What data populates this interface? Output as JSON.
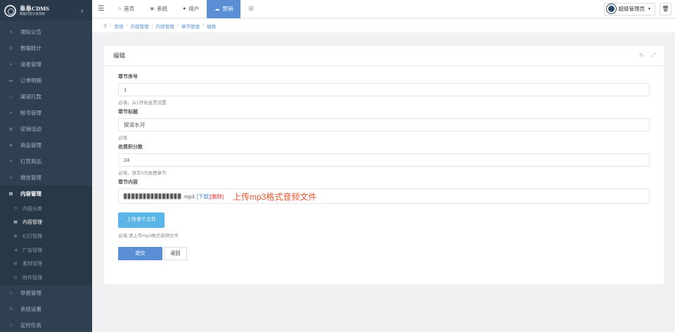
{
  "brand": {
    "title": "阜阜CDMS",
    "subtitle": "数据内容分发系统"
  },
  "sidebar": {
    "items": [
      {
        "label": "通知公告",
        "icon": "comment-icon"
      },
      {
        "label": "数据统计",
        "icon": "bar-chart-icon"
      },
      {
        "label": "读者管理",
        "icon": "users-icon"
      },
      {
        "label": "订单明细",
        "icon": "cart-icon"
      },
      {
        "label": "渠道打款",
        "icon": "money-icon"
      },
      {
        "label": "帐号管理",
        "icon": "user-icon"
      },
      {
        "label": "促销活动",
        "icon": "gift-icon"
      },
      {
        "label": "商品管理",
        "icon": "diamond-icon"
      },
      {
        "label": "打赏商品",
        "icon": "heart-icon"
      },
      {
        "label": "微信管理",
        "icon": "wechat-icon"
      },
      {
        "label": "内容管理",
        "icon": "book-icon"
      },
      {
        "label": "举报管理",
        "icon": "flag-icon"
      },
      {
        "label": "系统设置",
        "icon": "gear-icon"
      },
      {
        "label": "定时任务",
        "icon": "clock-icon"
      }
    ],
    "sub_items": [
      {
        "label": "内容分类",
        "icon": "list-icon"
      },
      {
        "label": "内容管理",
        "icon": "book-icon"
      },
      {
        "label": "幻灯管理",
        "icon": "image-icon"
      },
      {
        "label": "广告管理",
        "icon": "bullhorn-icon"
      },
      {
        "label": "素材管理",
        "icon": "file-icon"
      },
      {
        "label": "附件管理",
        "icon": "paperclip-icon"
      }
    ]
  },
  "topbar": {
    "tabs": [
      {
        "label": "首页",
        "icon": "home-icon"
      },
      {
        "label": "系统",
        "icon": "gear-icon"
      },
      {
        "label": "用户",
        "icon": "user-icon"
      },
      {
        "label": "营销",
        "icon": "cloud-icon"
      }
    ],
    "user_label": "超级管理员"
  },
  "breadcrumb": [
    "营销",
    "内容管理",
    "内容管理",
    "章节管理",
    "编辑"
  ],
  "panel": {
    "title": "编辑"
  },
  "form": {
    "chapter_no": {
      "label": "章节序号",
      "value": "1",
      "help": "必填，从1开始连贯设置"
    },
    "chapter_title": {
      "label": "章节标题",
      "value": "探清水河",
      "help": "必填"
    },
    "fee_points": {
      "label": "收费积分数",
      "value": "24",
      "help": "必填，填写0为免费章节"
    },
    "content": {
      "label": "章节内容",
      "file_ext": ".mp3",
      "download_label": "[下载]",
      "delete_label": "[删除]",
      "annotation": "上传mp3格式音频文件",
      "upload_label": "上传单个文件",
      "help": "必填,请上传mp3格式音频文件"
    },
    "submit_label": "提交",
    "back_label": "返回"
  },
  "colors": {
    "sidebar_bg": "#2f4050",
    "accent": "#5a8fd6",
    "upload": "#5bb5e8",
    "annotation": "#e4572e"
  }
}
